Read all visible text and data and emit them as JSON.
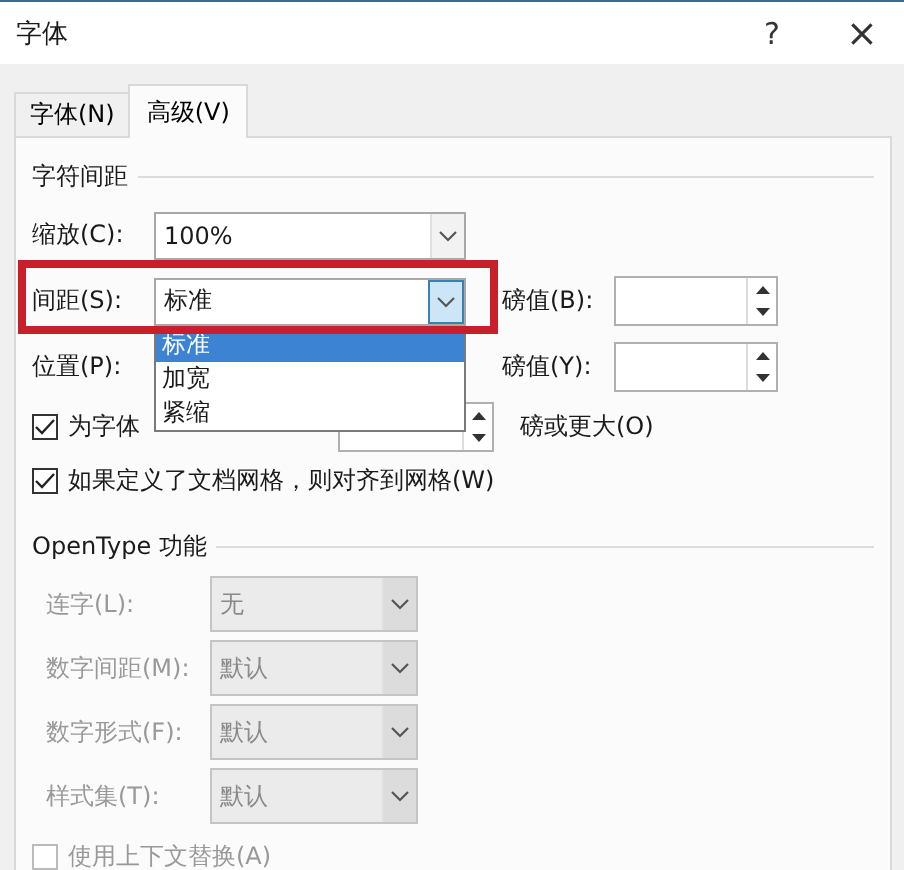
{
  "window": {
    "title": "字体",
    "help": "?",
    "close": "×"
  },
  "tabs": [
    {
      "label": "字体(N)",
      "selected": false
    },
    {
      "label": "高级(V)",
      "selected": true
    }
  ],
  "character_spacing": {
    "heading": "字符间距",
    "scale": {
      "label": "缩放(C):",
      "value": "100%"
    },
    "spacing": {
      "label": "间距(S):",
      "value": "标准",
      "expanded": true,
      "options": [
        {
          "label": "标准",
          "selected": true
        },
        {
          "label": "加宽",
          "selected": false
        },
        {
          "label": "紧缩",
          "selected": false
        }
      ]
    },
    "spacing_by": {
      "label": "磅值(B):"
    },
    "position": {
      "label": "位置(P):"
    },
    "position_by": {
      "label": "磅值(Y):"
    },
    "kerning": {
      "label": "为字体",
      "checked": true,
      "suffix": "磅或更大(O)"
    },
    "snap_grid": {
      "label": "如果定义了文档网格，则对齐到网格(W)",
      "checked": true
    }
  },
  "opentype": {
    "heading": "OpenType 功能",
    "rows": [
      {
        "label": "连字(L):",
        "value": "无",
        "disabled": true
      },
      {
        "label": "数字间距(M):",
        "value": "默认",
        "disabled": true
      },
      {
        "label": "数字形式(F):",
        "value": "默认",
        "disabled": true
      },
      {
        "label": "样式集(T):",
        "value": "默认",
        "disabled": true
      }
    ],
    "contextual": {
      "label": "使用上下文替换(A)",
      "checked": false,
      "disabled": true
    }
  },
  "annotations": [
    {
      "kind": "frame"
    }
  ]
}
